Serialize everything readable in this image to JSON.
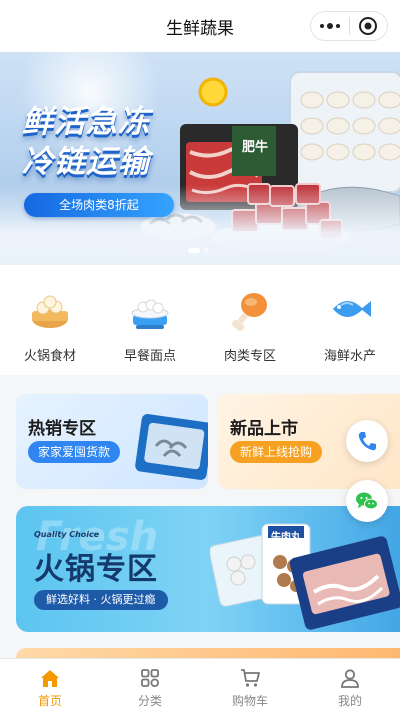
{
  "header": {
    "title": "生鲜蔬果"
  },
  "banner": {
    "headline_line1": "鲜活急冻",
    "headline_line2": "冷链运输",
    "promo_pill": "全场肉类8折起",
    "product_label": "肥牛"
  },
  "categories": [
    {
      "label": "火锅食材",
      "icon": "dumpling-basket-icon"
    },
    {
      "label": "早餐面点",
      "icon": "breakfast-pot-icon"
    },
    {
      "label": "肉类专区",
      "icon": "drumstick-icon"
    },
    {
      "label": "海鲜水产",
      "icon": "fish-icon"
    }
  ],
  "promos": [
    {
      "title": "热销专区",
      "tag": "家家爱囤货款"
    },
    {
      "title": "新品上市",
      "tag": "新鲜上线抢购"
    }
  ],
  "hotpot": {
    "quality": "Quality Choice",
    "watermark": "Fresh",
    "title": "火锅专区",
    "subtitle": "鲜选好料 · 火锅更过瘾",
    "pack_label": "牛肉丸"
  },
  "tabbar": [
    {
      "label": "首页",
      "icon": "home-icon",
      "active": true
    },
    {
      "label": "分类",
      "icon": "grid-icon",
      "active": false
    },
    {
      "label": "购物车",
      "icon": "cart-icon",
      "active": false
    },
    {
      "label": "我的",
      "icon": "user-icon",
      "active": false
    }
  ],
  "colors": {
    "accent": "#f39800",
    "brand_blue": "#2f86f0",
    "tab_inactive": "#888888"
  }
}
